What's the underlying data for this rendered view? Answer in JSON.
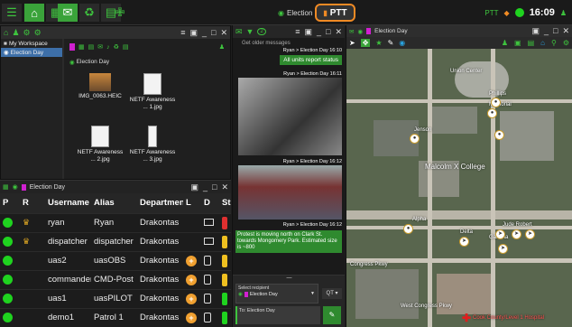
{
  "topbar": {
    "mission": "Election Day",
    "ptt_label": "PTT",
    "ptt_status": "PTT",
    "clock": "16:09"
  },
  "workspace": {
    "tree": [
      {
        "label": "My Workspace"
      },
      {
        "label": "Election Day"
      }
    ],
    "path": "Election Day",
    "files": [
      {
        "name": "IMG_0063.HEIC"
      },
      {
        "name": "NETF Awareness ... 1.jpg"
      },
      {
        "name": "NETF Awareness ... 2.jpg"
      },
      {
        "name": "NETF Awareness ... 3.jpg"
      }
    ]
  },
  "user_table": {
    "mission": "Election Day",
    "columns": [
      "P",
      "R",
      "Username",
      "Alias",
      "Department",
      "L",
      "D",
      "St"
    ],
    "rows": [
      {
        "username": "ryan",
        "alias": "Ryan",
        "department": "Drakontas",
        "role": "crown",
        "device": "pc",
        "status": "#e03030"
      },
      {
        "username": "dispatcher",
        "alias": "dispatcher",
        "department": "Drakontas",
        "role": "crown",
        "device": "pc",
        "status": "#f0c020"
      },
      {
        "username": "uas2",
        "alias": "uasOBS",
        "department": "Drakontas",
        "role": "",
        "device": "phone",
        "status": "#f0c020"
      },
      {
        "username": "commander",
        "alias": "CMD-Post",
        "department": "Drakontas",
        "role": "",
        "device": "phone",
        "status": "#f0c020"
      },
      {
        "username": "uas1",
        "alias": "uasPILOT",
        "department": "Drakontas",
        "role": "",
        "device": "phone",
        "status": "#1fd31f"
      },
      {
        "username": "demo1",
        "alias": "Patrol 1",
        "department": "Drakontas",
        "role": "",
        "device": "phone",
        "status": "#1fd31f"
      }
    ]
  },
  "chat": {
    "badge": "2",
    "older_label": "Get older messages",
    "messages": [
      {
        "sender": "Ryan",
        "channel": "Election Day",
        "time": "16:10",
        "text": "All units report status"
      },
      {
        "sender": "Ryan",
        "channel": "Election Day",
        "time": "16:11",
        "text": ""
      },
      {
        "sender": "Ryan",
        "channel": "Election Day",
        "time": "16:12",
        "text": ""
      },
      {
        "sender": "Ryan",
        "channel": "Election Day",
        "time": "16:12",
        "text": "Protest is moving north on Clark St. towards Mongomery Park. Estimated size is ~800"
      }
    ],
    "recipient_label": "Select recipient",
    "recipient_value": "Election Day",
    "qt_label": "QT",
    "to_label": "To: Election Day"
  },
  "map": {
    "title": "Election Day",
    "labels": [
      "Union Center",
      "Phillips",
      "Memorial",
      "Jenson",
      "Malcolm X College",
      "Alpha",
      "Delta",
      "Gamma",
      "Jude Robert",
      "Cook County/Level 1 Hospital",
      "Congress Pkwy",
      "West Congress Pkwy"
    ]
  },
  "colors": {
    "accent": "#3ec43e",
    "ptt_border": "#f08a24",
    "chat_green": "#2f8a2f",
    "selection": "#3d6fa8",
    "hospital": "#e01e1e"
  }
}
